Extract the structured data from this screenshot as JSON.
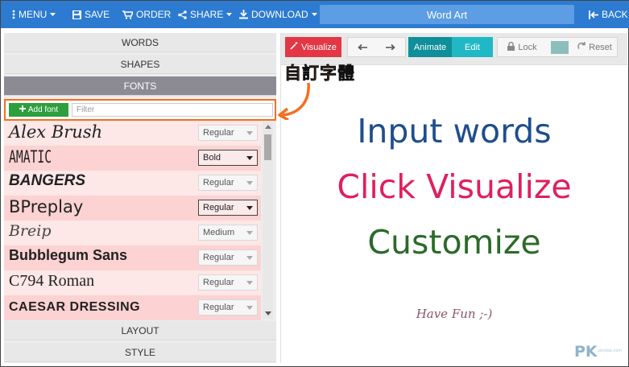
{
  "topbar": {
    "menu": "MENU",
    "save": "SAVE",
    "order": "ORDER",
    "share": "SHARE",
    "download": "DOWNLOAD",
    "title": "Word Art",
    "back": "BACK"
  },
  "sidebar": {
    "sections": {
      "words": "WORDS",
      "shapes": "SHAPES",
      "fonts": "FONTS",
      "layout": "LAYOUT",
      "style": "STYLE"
    },
    "add_font": "Add font",
    "filter_placeholder": "Filter",
    "fonts": [
      {
        "name": "Alex Brush",
        "style": "Regular"
      },
      {
        "name": "AMATIC",
        "style": "Bold"
      },
      {
        "name": "BANGERS",
        "style": "Regular"
      },
      {
        "name": "BPreplay",
        "style": "Regular"
      },
      {
        "name": "Breip",
        "style": "Medium"
      },
      {
        "name": "Bubblegum Sans",
        "style": "Regular"
      },
      {
        "name": "C794 Roman",
        "style": "Regular"
      },
      {
        "name": "CAESAR DRESSING",
        "style": "Regular"
      }
    ]
  },
  "annotation": "自訂字體",
  "toolbar": {
    "visualize": "Visualize",
    "animate": "Animate",
    "edit": "Edit",
    "lock": "Lock",
    "reset": "Reset"
  },
  "canvas": {
    "line1": "Input words",
    "line2": "Click Visualize",
    "line3": "Customize",
    "line4": "Have Fun ;-)"
  },
  "watermark": {
    "logo": "PK",
    "small": "pkstep.com"
  },
  "colors": {
    "topbar": "#2c7bd1",
    "add_font": "#2e9e3f",
    "visualize": "#e33745",
    "animate": "#0e8f9a",
    "edit": "#21b8c6",
    "annotation": "#f36f21"
  }
}
